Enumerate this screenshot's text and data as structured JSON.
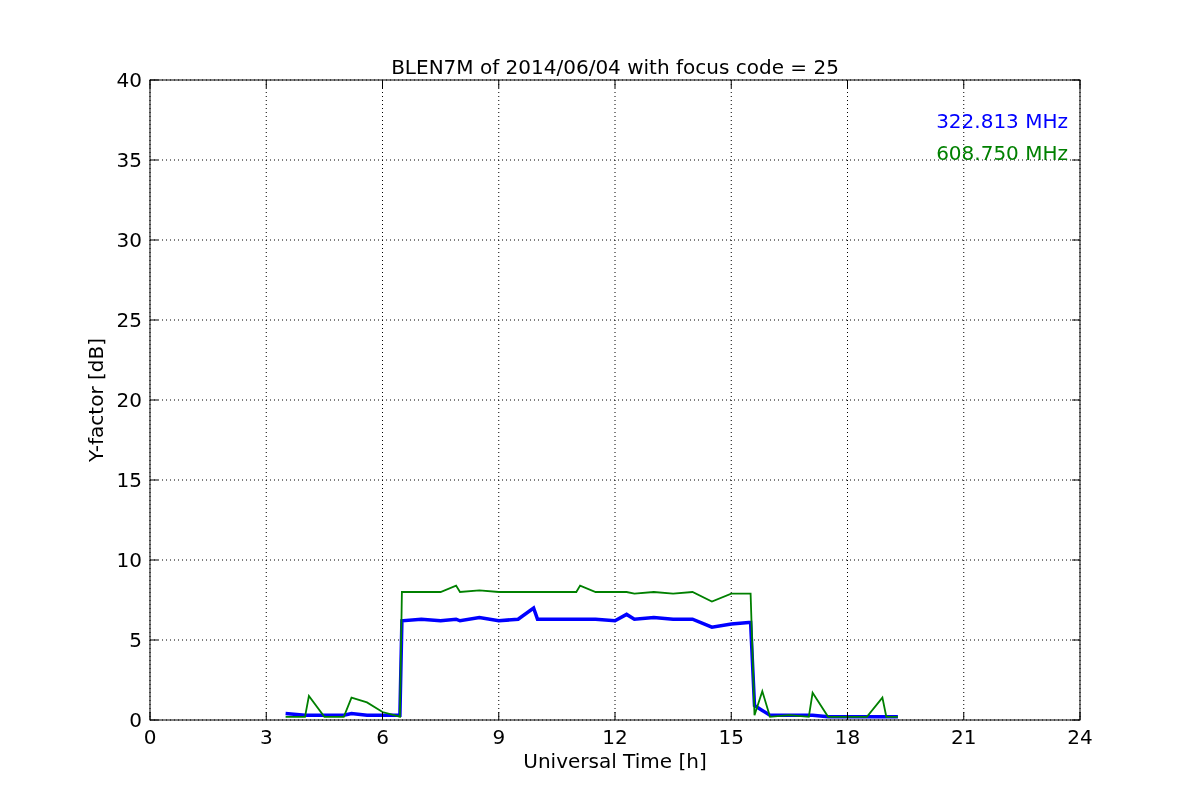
{
  "chart_data": {
    "type": "line",
    "title": "BLEN7M of 2014/06/04 with focus code = 25",
    "xlabel": "Universal Time [h]",
    "ylabel": "Y-factor [dB]",
    "x": [
      3.5,
      4.0,
      4.1,
      4.5,
      5.0,
      5.2,
      5.6,
      6.0,
      6.3,
      6.45,
      6.5,
      7,
      7.5,
      7.9,
      8,
      8.5,
      9,
      9.5,
      9.9,
      10,
      10.5,
      11,
      11.1,
      11.5,
      12,
      12.3,
      12.5,
      13,
      13.5,
      14,
      14.5,
      15,
      15.45,
      15.5,
      15.6,
      15.8,
      16,
      16.5,
      17,
      17.1,
      17.5,
      18,
      18.5,
      18.9,
      19,
      19.3
    ],
    "series": [
      {
        "name": "322.813 MHz",
        "color": "#0000ff",
        "values": [
          0.4,
          0.3,
          0.3,
          0.3,
          0.3,
          0.4,
          0.3,
          0.3,
          0.3,
          0.3,
          6.2,
          6.3,
          6.2,
          6.3,
          6.2,
          6.4,
          6.2,
          6.3,
          7.0,
          6.3,
          6.3,
          6.3,
          6.3,
          6.3,
          6.2,
          6.6,
          6.3,
          6.4,
          6.3,
          6.3,
          5.8,
          6.0,
          6.1,
          6.1,
          0.9,
          0.6,
          0.3,
          0.3,
          0.3,
          0.3,
          0.2,
          0.2,
          0.2,
          0.2,
          0.2,
          0.2
        ]
      },
      {
        "name": "608.750 MHz",
        "color": "#008000",
        "values": [
          0.2,
          0.2,
          1.5,
          0.2,
          0.2,
          1.4,
          1.1,
          0.5,
          0.3,
          0.2,
          8.0,
          8.0,
          8.0,
          8.4,
          8.0,
          8.1,
          8.0,
          8.0,
          8.0,
          8.0,
          8.0,
          8.0,
          8.4,
          8.0,
          8.0,
          8.0,
          7.9,
          8.0,
          7.9,
          8.0,
          7.4,
          7.9,
          7.9,
          7.9,
          0.3,
          1.8,
          0.2,
          0.3,
          0.2,
          1.7,
          0.2,
          0.2,
          0.2,
          1.4,
          0.2,
          0.2
        ]
      }
    ],
    "xlim": [
      0,
      24
    ],
    "ylim": [
      0,
      40
    ],
    "xticks": [
      0,
      3,
      6,
      9,
      12,
      15,
      18,
      21,
      24
    ],
    "yticks": [
      0,
      5,
      10,
      15,
      20,
      25,
      30,
      35,
      40
    ],
    "grid": true
  }
}
